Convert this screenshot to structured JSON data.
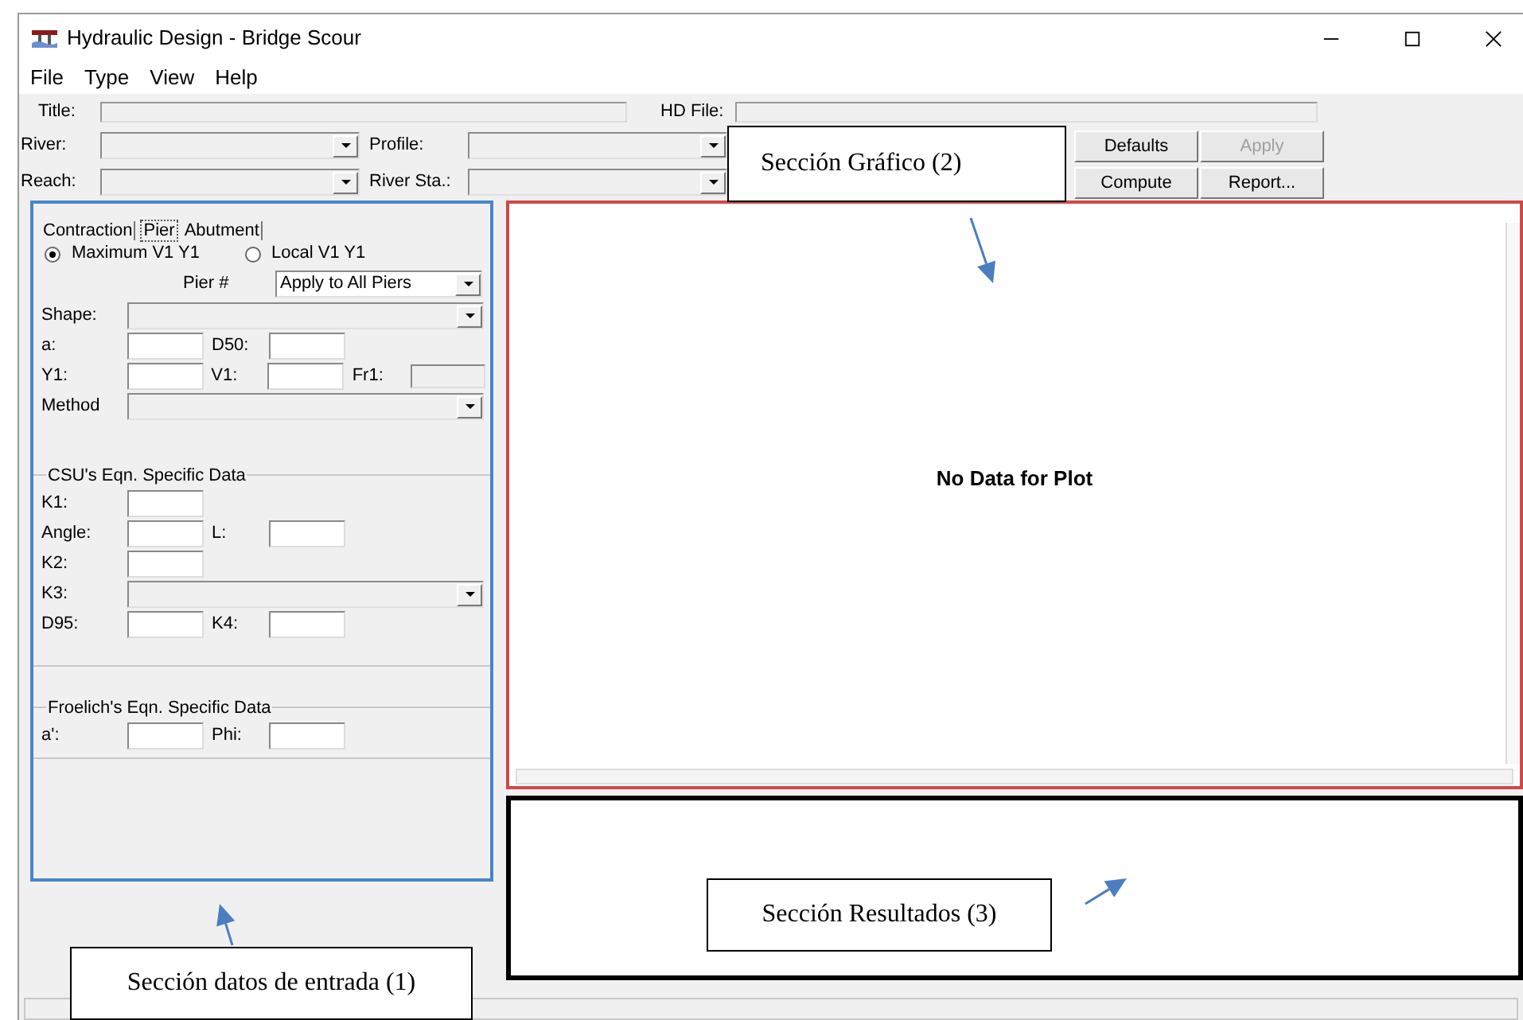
{
  "window": {
    "title": "Hydraulic Design - Bridge Scour"
  },
  "menu": [
    "File",
    "Type",
    "View",
    "Help"
  ],
  "header": {
    "title_label": "Title:",
    "hd_file_label": "HD File:",
    "river_label": "River:",
    "profile_label": "Profile:",
    "reach_label": "Reach:",
    "river_sta_label": "River Sta.:"
  },
  "buttons": [
    {
      "label": "Defaults",
      "disabled": false
    },
    {
      "label": "Apply",
      "disabled": true
    },
    {
      "label": "Compute",
      "disabled": false
    },
    {
      "label": "Report...",
      "disabled": false
    }
  ],
  "tabs": [
    {
      "label": "Contraction",
      "selected": false
    },
    {
      "label": "Pier",
      "selected": true
    },
    {
      "label": "Abutment",
      "selected": false
    }
  ],
  "velocity_options": [
    {
      "label": "Maximum V1 Y1",
      "selected": true
    },
    {
      "label": "Local V1 Y1",
      "selected": false
    }
  ],
  "pier": {
    "label": "Pier #",
    "value": "Apply to All Piers"
  },
  "pier_rows": [
    [
      {
        "label": "Shape:",
        "kind": "dropdown"
      }
    ],
    [
      {
        "label": "a:",
        "kind": "field"
      },
      {
        "label": "D50:",
        "kind": "field"
      }
    ],
    [
      {
        "label": "Y1:",
        "kind": "field"
      },
      {
        "label": "V1:",
        "kind": "field"
      },
      {
        "label": "Fr1:",
        "kind": "readonly"
      }
    ],
    [
      {
        "label": "Method",
        "kind": "dropdown"
      }
    ]
  ],
  "groups": [
    {
      "title": "CSU's Eqn. Specific Data",
      "rows": [
        [
          {
            "label": "K1:",
            "kind": "field"
          }
        ],
        [
          {
            "label": "Angle:",
            "kind": "field"
          },
          {
            "label": "L:",
            "kind": "field"
          }
        ],
        [
          {
            "label": "K2:",
            "kind": "field"
          }
        ],
        [
          {
            "label": "K3:",
            "kind": "dropdown"
          }
        ],
        [
          {
            "label": "D95:",
            "kind": "field"
          },
          {
            "label": "K4:",
            "kind": "field"
          }
        ]
      ]
    },
    {
      "title": "Froelich's Eqn. Specific Data",
      "rows": [
        [
          {
            "label": "a':",
            "kind": "field"
          },
          {
            "label": "Phi:",
            "kind": "field"
          }
        ]
      ]
    }
  ],
  "plot": {
    "message": "No Data for Plot"
  },
  "annotations": [
    {
      "text": "Sección Gráfico (2)"
    },
    {
      "text": "Sección Resultados (3)"
    },
    {
      "text": "Sección datos de entrada (1)"
    }
  ]
}
